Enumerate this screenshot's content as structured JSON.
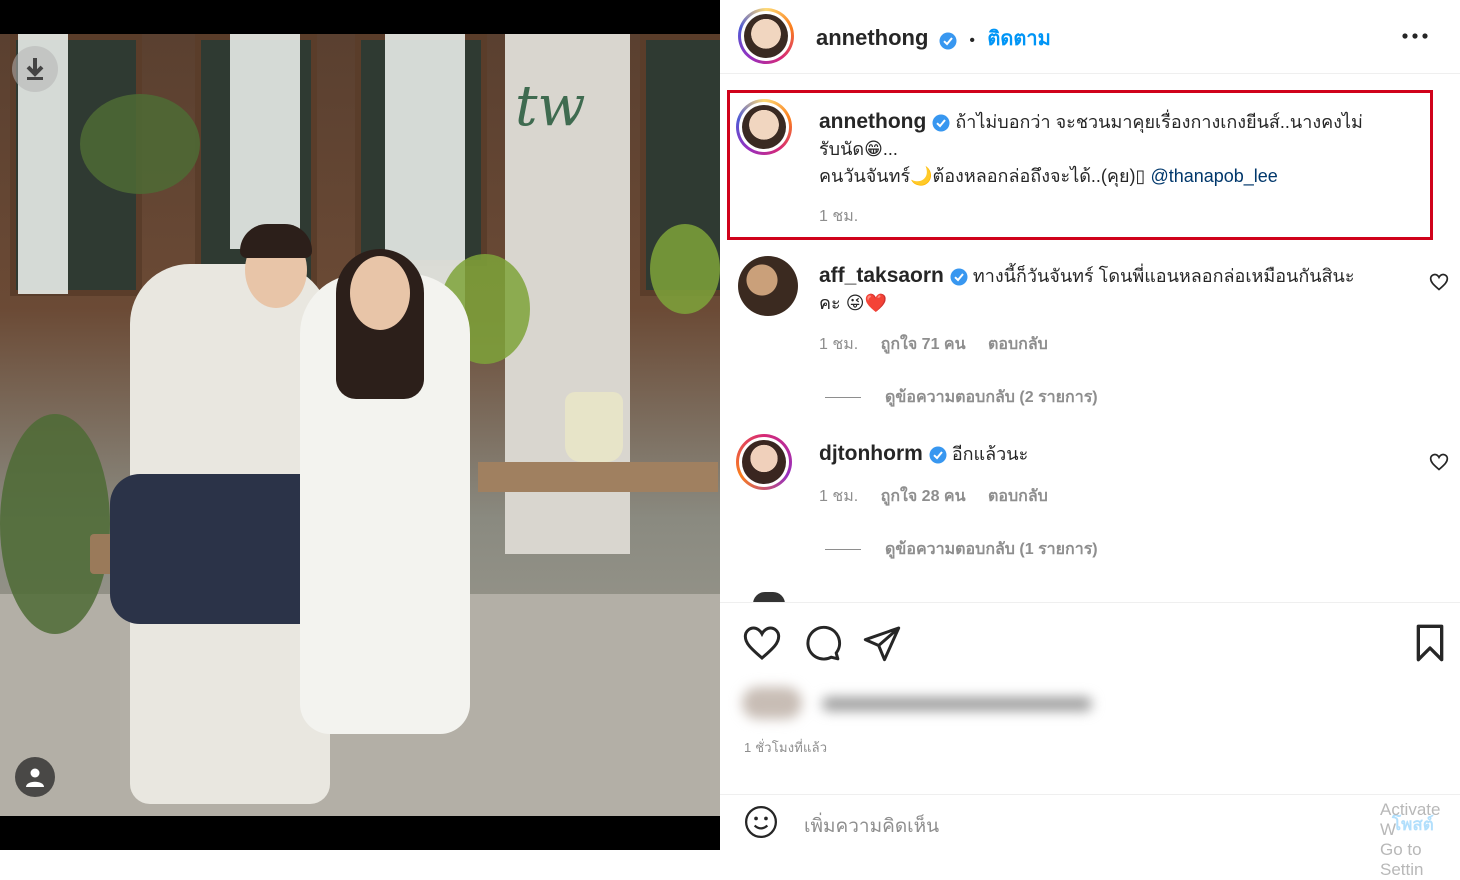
{
  "post": {
    "author": "annethong",
    "follow_label": "ติดตาม",
    "more_label": "•••"
  },
  "caption": {
    "username": "annethong",
    "line1": "ถ้าไม่บอกว่า จะชวนมาคุยเรื่องกางเกงยีนส์..นางคงไม่",
    "line2": "รับนัด😁...",
    "line3": "คนวันจันทร์🌙ต้องหลอกล่อถึงจะได้..(คุย)▯",
    "mention": "@thanapob_lee",
    "time": "1 ชม."
  },
  "comments": [
    {
      "username": "aff_taksaorn",
      "text1": "ทางนี้ก็วันจันทร์ โดนพี่แอนหลอกล่อเหมือนกันสินะ",
      "text2": "คะ 😜❤️",
      "time": "1 ชม.",
      "likes": "ถูกใจ 71 คน",
      "reply": "ตอบกลับ",
      "view_replies": "ดูข้อความตอบกลับ (2 รายการ)"
    },
    {
      "username": "djtonhorm",
      "text1": "อีกแล้วนะ",
      "time": "1 ชม.",
      "likes": "ถูกใจ 28 คน",
      "reply": "ตอบกลับ",
      "view_replies": "ดูข้อความตอบกลับ (1 รายการ)"
    }
  ],
  "footer": {
    "timestamp": "1 ชั่วโมงที่แล้ว",
    "add_comment_placeholder": "เพิ่มความคิดเห็น",
    "post_label": "โพสต์"
  },
  "watermark": {
    "line1": "Activate W",
    "line2": "Go to Settin"
  },
  "photo": {
    "sign_text": "tw"
  },
  "colors": {
    "accent": "#0095f6",
    "highlight_border": "#d0021b",
    "mention": "#00376b",
    "verified": "#3897f0"
  },
  "icons": [
    "download-icon",
    "user-tag-icon",
    "verified-icon",
    "more-icon",
    "heart-icon",
    "comment-icon",
    "share-icon",
    "bookmark-icon",
    "emoji-icon"
  ]
}
